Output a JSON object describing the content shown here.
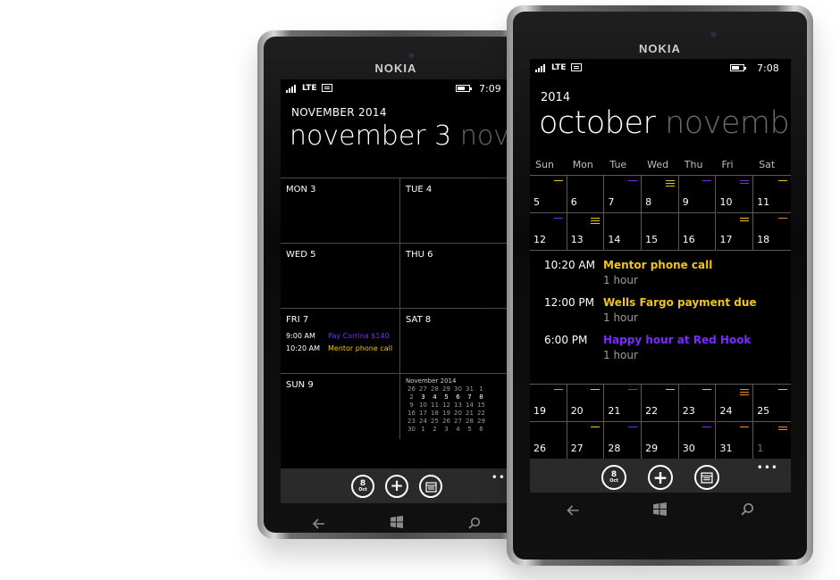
{
  "colors": {
    "yellow": "#f0c419",
    "purple": "#7a2cff",
    "orange": "#f08a24",
    "screen": "#000000"
  },
  "icons": [
    "signal-icon",
    "message-icon",
    "battery-icon",
    "add-icon",
    "calendar-today-icon",
    "month-view-icon",
    "more-icon",
    "back-icon",
    "windows-icon",
    "search-icon"
  ],
  "back_phone": {
    "brand": "NOKIA",
    "status": {
      "network": "LTE",
      "time": "7:09"
    },
    "header_small": "NOVEMBER 2014",
    "header_big": "november 3",
    "header_next": "nove",
    "days": [
      {
        "label": "MON 3"
      },
      {
        "label": "TUE 4"
      },
      {
        "label": "WED 5"
      },
      {
        "label": "THU 6"
      },
      {
        "label": "FRI 7"
      },
      {
        "label": "SAT 8"
      },
      {
        "label": "SUN 9"
      }
    ],
    "fri_events": [
      {
        "time": "9:00 AM",
        "title": "Pay Corrina $140"
      },
      {
        "time": "10:20 AM",
        "title": "Mentor phone call"
      }
    ],
    "mini_cal": {
      "title": "November 2014",
      "rows": [
        [
          "26",
          "27",
          "28",
          "29",
          "30",
          "31",
          "1"
        ],
        [
          "2",
          "3",
          "4",
          "5",
          "6",
          "7",
          "8"
        ],
        [
          "9",
          "10",
          "11",
          "12",
          "13",
          "14",
          "15"
        ],
        [
          "16",
          "17",
          "18",
          "19",
          "20",
          "21",
          "22"
        ],
        [
          "23",
          "24",
          "25",
          "26",
          "27",
          "28",
          "29"
        ],
        [
          "30",
          "1",
          "2",
          "3",
          "4",
          "5",
          "6"
        ]
      ]
    },
    "appbar": {
      "today_num": "8",
      "today_mon": "Oct",
      "more": "•••"
    }
  },
  "front_phone": {
    "brand": "NOKIA",
    "status": {
      "network": "LTE",
      "time": "7:08"
    },
    "year": "2014",
    "month": "october",
    "month_next": "novembe",
    "weekdays": [
      "Sun",
      "Mon",
      "Tue",
      "Wed",
      "Thu",
      "Fri",
      "Sat"
    ],
    "week1": [
      "5",
      "6",
      "7",
      "8",
      "9",
      "10",
      "11"
    ],
    "week2": [
      "12",
      "13",
      "14",
      "15",
      "16",
      "17",
      "18"
    ],
    "week3": [
      "19",
      "20",
      "21",
      "22",
      "23",
      "24",
      "25"
    ],
    "week4": [
      "26",
      "27",
      "28",
      "29",
      "30",
      "31",
      "1"
    ],
    "events": [
      {
        "time": "10:20 AM",
        "title": "Mentor phone call",
        "duration": "1 hour"
      },
      {
        "time": "12:00 PM",
        "title": "Wells Fargo payment due",
        "duration": "1 hour"
      },
      {
        "time": "6:00 PM",
        "title": "Happy hour at Red Hook",
        "duration": "1 hour"
      }
    ],
    "appbar": {
      "today_num": "8",
      "today_mon": "Oct",
      "more": "•••"
    }
  }
}
